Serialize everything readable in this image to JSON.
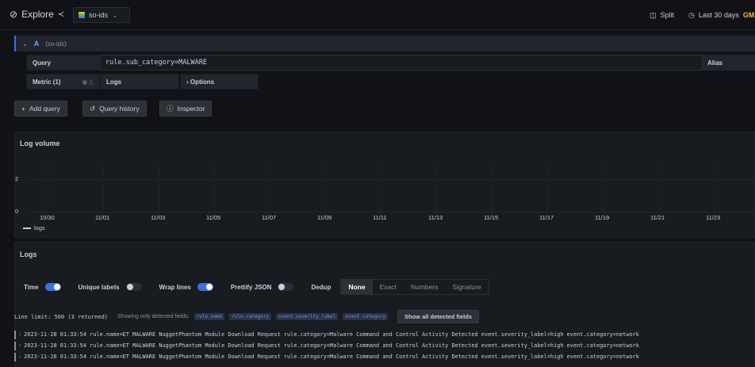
{
  "topbar": {
    "title": "Explore",
    "datasource": "so-ids",
    "split_label": "Split",
    "time_range": "Last 30 days",
    "timezone": "GM"
  },
  "query": {
    "ref_id": "A",
    "datasource_hint": "(so-ids)",
    "query_label": "Query",
    "query_text": "rule.sub_category=MALWARE",
    "alias_label": "Alias",
    "metric_label": "Metric (1)",
    "logs_label": "Logs",
    "options_label": "› Options"
  },
  "actions": {
    "add_query": "Add query",
    "query_history": "Query history",
    "inspector": "Inspector"
  },
  "log_volume": {
    "title": "Log volume",
    "legend": "logs"
  },
  "chart_data": {
    "type": "bar",
    "title": "Log volume",
    "categories": [
      "10/30",
      "11/01",
      "11/03",
      "11/05",
      "11/07",
      "11/09",
      "11/11",
      "11/13",
      "11/15",
      "11/17",
      "11/19",
      "11/21",
      "11/23"
    ],
    "y_ticks": [
      "2",
      "0"
    ],
    "ylim": [
      0,
      3
    ],
    "series": [
      {
        "name": "logs",
        "values": [
          0,
          0,
          0,
          0,
          0,
          0,
          0,
          0,
          0,
          0,
          0,
          0,
          0
        ]
      }
    ],
    "grid": true,
    "legend": "bottom-left"
  },
  "logs_panel": {
    "title": "Logs",
    "time_label": "Time",
    "unique_labels": "Unique labels",
    "wrap_lines": "Wrap lines",
    "prettify_json": "Prettify JSON",
    "dedup": "Dedup",
    "dedup_options": [
      "None",
      "Exact",
      "Numbers",
      "Signature"
    ],
    "line_limit": "Line limit: 500 (3 returned)",
    "showing_fields": "Showing only detected fields:",
    "fields": [
      "rule.name",
      "rule.category",
      "event.severity_label",
      "event.category"
    ],
    "show_all": "Show all detected fields"
  },
  "log_rows": [
    "2023-11-28 01:33:54 rule.name=ET MALWARE NuggetPhantom Module Download Request rule.category=Malware Command and Control Activity Detected event.severity_label=high event.category=network",
    "2023-11-28 01:33:54 rule.name=ET MALWARE NuggetPhantom Module Download Request rule.category=Malware Command and Control Activity Detected event.severity_label=high event.category=network",
    "2023-11-28 01:33:54 rule.name=ET MALWARE NuggetPhantom Module Download Request rule.category=Malware Command and Control Activity Detected event.severity_label=high event.category=network"
  ],
  "colors": {
    "accent": "#3d71d9",
    "background": "#111217",
    "panel": "#181b1f",
    "timezone": "#f5b73b"
  }
}
